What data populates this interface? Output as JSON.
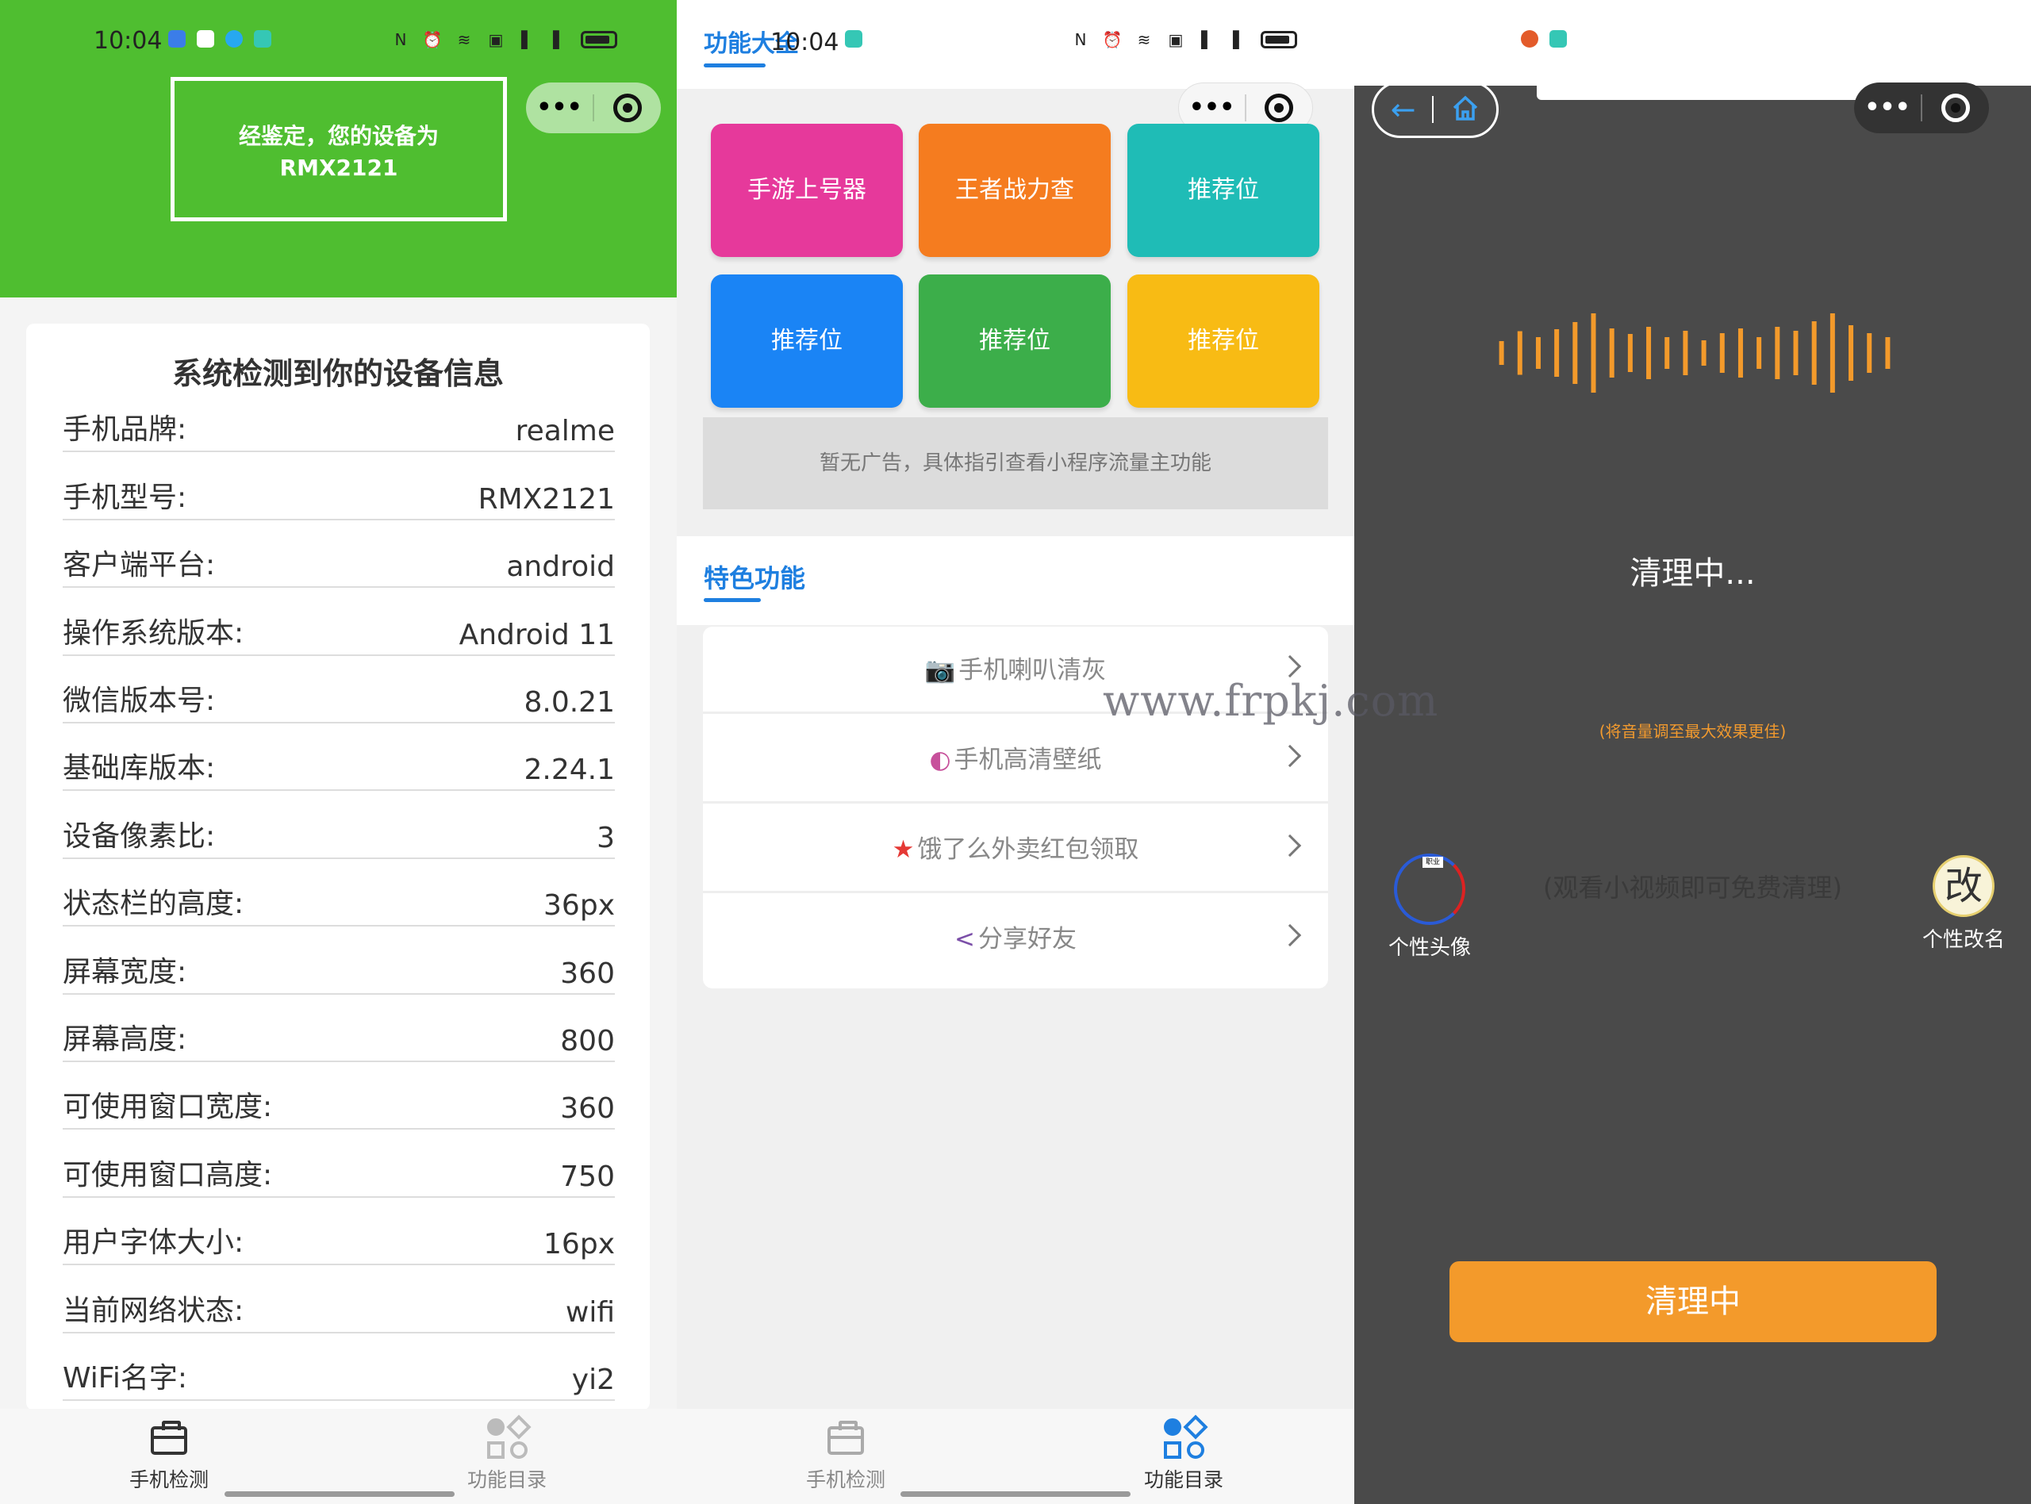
{
  "status": {
    "time": "10:04"
  },
  "panel1": {
    "result_line1": "经鉴定，您的设备为",
    "result_line2": "RMX2121",
    "card_title": "系统检测到你的设备信息",
    "rows": [
      {
        "key": "手机品牌:",
        "value": "realme"
      },
      {
        "key": "手机型号:",
        "value": "RMX2121"
      },
      {
        "key": "客户端平台:",
        "value": "android"
      },
      {
        "key": "操作系统版本:",
        "value": "Android 11"
      },
      {
        "key": "微信版本号:",
        "value": "8.0.21"
      },
      {
        "key": "基础库版本:",
        "value": "2.24.1"
      },
      {
        "key": "设备像素比:",
        "value": "3"
      },
      {
        "key": "状态栏的高度:",
        "value": "36px"
      },
      {
        "key": "屏幕宽度:",
        "value": "360"
      },
      {
        "key": "屏幕高度:",
        "value": "800"
      },
      {
        "key": "可使用窗口宽度:",
        "value": "360"
      },
      {
        "key": "可使用窗口高度:",
        "value": "750"
      },
      {
        "key": "用户字体大小:",
        "value": "16px"
      },
      {
        "key": "当前网络状态:",
        "value": "wifi"
      },
      {
        "key": "WiFi名字:",
        "value": "yi2"
      }
    ]
  },
  "tabs": {
    "detect": "手机检测",
    "catalog": "功能目录"
  },
  "panel2": {
    "title": "功能大全",
    "tiles": [
      {
        "label": "手游上号器",
        "color": "#e6399b"
      },
      {
        "label": "王者战力查",
        "color": "#f57c1f"
      },
      {
        "label": "推荐位",
        "color": "#1fbcb6"
      },
      {
        "label": "推荐位",
        "color": "#1a84f5"
      },
      {
        "label": "推荐位",
        "color": "#3cae4a"
      },
      {
        "label": "推荐位",
        "color": "#f8bb14"
      }
    ],
    "ad_text": "暂无广告，具体指引查看小程序流量主功能",
    "features_title": "特色功能",
    "features": [
      {
        "label": "手机喇叭清灰",
        "icon": "camera-icon",
        "glyph": "📷",
        "glyph_color": "#e06060"
      },
      {
        "label": "手机高清壁纸",
        "icon": "wallpaper-icon",
        "glyph": "◐",
        "glyph_color": "#c7509b"
      },
      {
        "label": "饿了么外卖红包领取",
        "icon": "star-icon",
        "glyph": "★",
        "glyph_color": "#e53935"
      },
      {
        "label": "分享好友",
        "icon": "share-icon",
        "glyph": "<",
        "glyph_color": "#7b4fa8"
      }
    ],
    "watermark": "www.frpkj.com"
  },
  "panel3": {
    "cleaning_title": "清理中...",
    "volume_tip": "(将音量调至最大效果更佳)",
    "video_tip": "(观看小视频即可免费清理)",
    "avatar_label": "个性头像",
    "avatar_badge": "职业",
    "rename_glyph": "改",
    "rename_label": "个性改名",
    "button_label": "清理中",
    "accent_color": "#f39a2b"
  }
}
